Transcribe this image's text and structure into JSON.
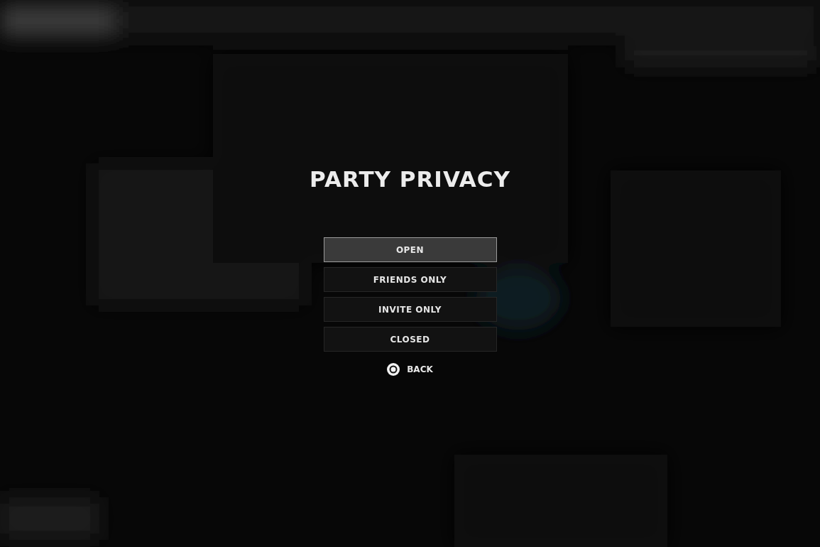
{
  "dialog": {
    "title": "PARTY PRIVACY",
    "options": [
      {
        "label": "OPEN",
        "selected": true
      },
      {
        "label": "FRIENDS ONLY",
        "selected": false
      },
      {
        "label": "INVITE ONLY",
        "selected": false
      },
      {
        "label": "CLOSED",
        "selected": false
      }
    ],
    "back": {
      "label": "BACK"
    }
  }
}
